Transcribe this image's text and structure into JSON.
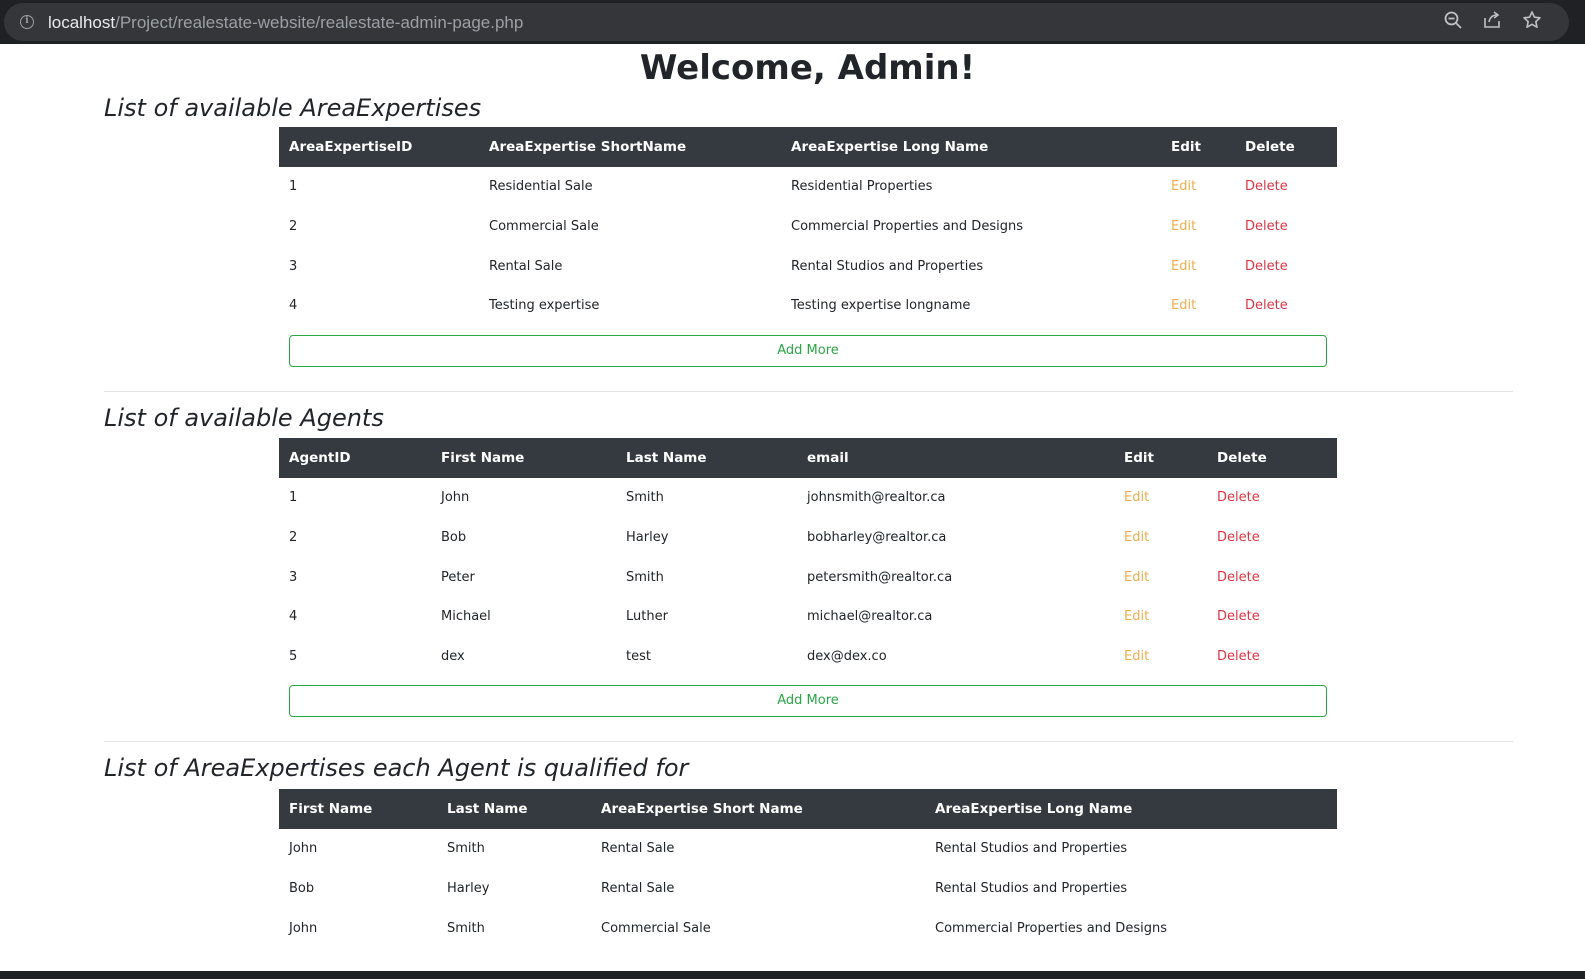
{
  "browser": {
    "url_host": "localhost",
    "url_path": "/Project/realestate-website/realestate-admin-page.php"
  },
  "page": {
    "title": "Welcome, Admin!"
  },
  "expertises": {
    "heading": "List of available AreaExpertises",
    "columns": [
      "AreaExpertiseID",
      "AreaExpertise ShortName",
      "AreaExpertise Long Name",
      "Edit",
      "Delete"
    ],
    "rows": [
      {
        "id": "1",
        "short": "Residential Sale",
        "long": "Residential Properties",
        "edit": "Edit",
        "delete": "Delete"
      },
      {
        "id": "2",
        "short": "Commercial Sale",
        "long": "Commercial Properties and Designs",
        "edit": "Edit",
        "delete": "Delete"
      },
      {
        "id": "3",
        "short": "Rental Sale",
        "long": "Rental Studios and Properties",
        "edit": "Edit",
        "delete": "Delete"
      },
      {
        "id": "4",
        "short": "Testing expertise",
        "long": "Testing expertise longname",
        "edit": "Edit",
        "delete": "Delete"
      }
    ],
    "add_label": "Add More"
  },
  "agents": {
    "heading": "List of available Agents",
    "columns": [
      "AgentID",
      "First Name",
      "Last Name",
      "email",
      "Edit",
      "Delete"
    ],
    "rows": [
      {
        "id": "1",
        "first": "John",
        "last": "Smith",
        "email": "johnsmith@realtor.ca",
        "edit": "Edit",
        "delete": "Delete"
      },
      {
        "id": "2",
        "first": "Bob",
        "last": "Harley",
        "email": "bobharley@realtor.ca",
        "edit": "Edit",
        "delete": "Delete"
      },
      {
        "id": "3",
        "first": "Peter",
        "last": "Smith",
        "email": "petersmith@realtor.ca",
        "edit": "Edit",
        "delete": "Delete"
      },
      {
        "id": "4",
        "first": "Michael",
        "last": "Luther",
        "email": "michael@realtor.ca",
        "edit": "Edit",
        "delete": "Delete"
      },
      {
        "id": "5",
        "first": "dex",
        "last": "test",
        "email": "dex@dex.co",
        "edit": "Edit",
        "delete": "Delete"
      }
    ],
    "add_label": "Add More"
  },
  "qualifications": {
    "heading": "List of AreaExpertises each Agent is qualified for",
    "columns": [
      "First Name",
      "Last Name",
      "AreaExpertise Short Name",
      "AreaExpertise Long Name"
    ],
    "rows": [
      {
        "first": "John",
        "last": "Smith",
        "short": "Rental Sale",
        "long": "Rental Studios and Properties"
      },
      {
        "first": "Bob",
        "last": "Harley",
        "short": "Rental Sale",
        "long": "Rental Studios and Properties"
      },
      {
        "first": "John",
        "last": "Smith",
        "short": "Commercial Sale",
        "long": "Commercial Properties and Designs"
      }
    ]
  },
  "colors": {
    "header_bg": "#343a40",
    "edit": "#f0ad4e",
    "delete": "#dc3545",
    "add": "#28a745"
  },
  "icons": [
    "info-icon",
    "zoom-out-icon",
    "share-icon",
    "star-icon"
  ]
}
